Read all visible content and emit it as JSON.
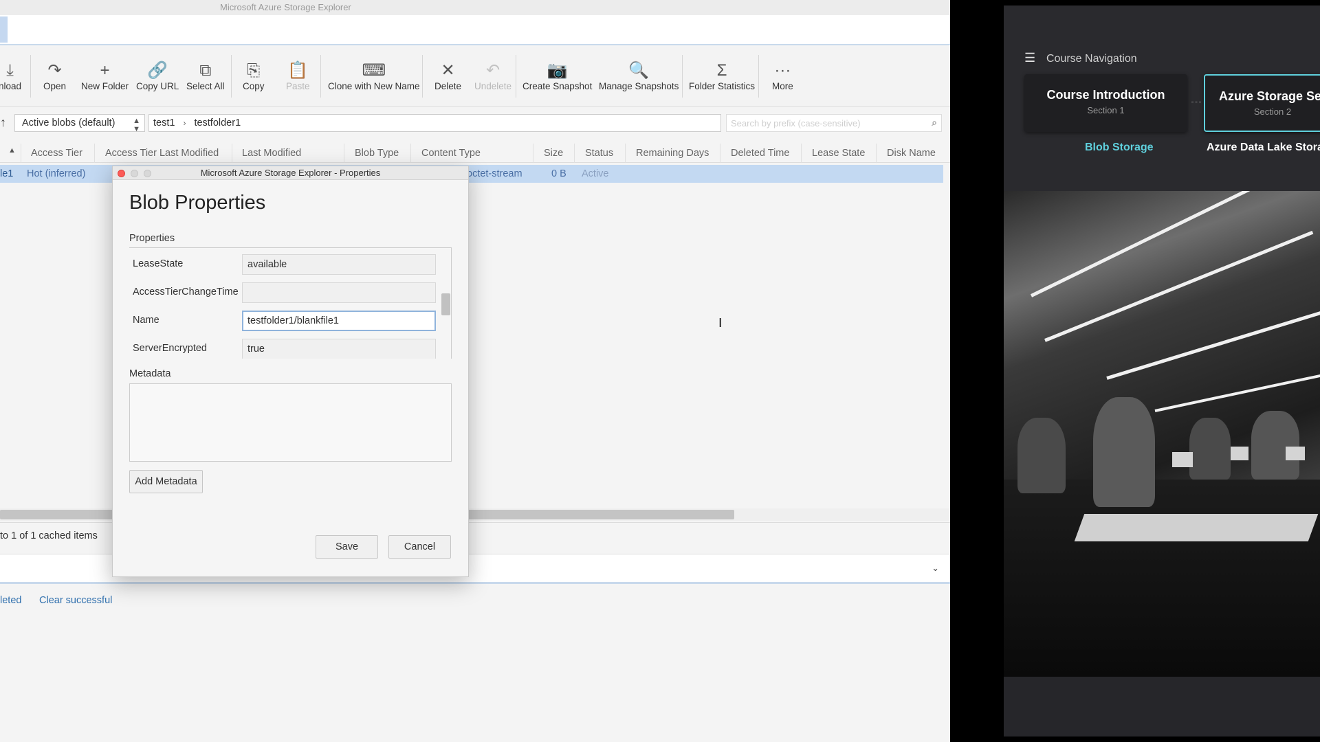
{
  "app": {
    "title": "Microsoft Azure Storage Explorer",
    "toolbar": {
      "download": "nload",
      "open": "Open",
      "new_folder": "New Folder",
      "copy_url": "Copy URL",
      "select_all": "Select All",
      "copy": "Copy",
      "paste": "Paste",
      "clone": "Clone with New Name",
      "delete": "Delete",
      "undelete": "Undelete",
      "create_snapshot": "Create Snapshot",
      "manage_snapshots": "Manage Snapshots",
      "folder_statistics": "Folder Statistics",
      "more": "More"
    },
    "view_selector": "Active blobs (default)",
    "breadcrumb": [
      "test1",
      "testfolder1"
    ],
    "search_placeholder": "Search by prefix (case-sensitive)",
    "columns": [
      "Access Tier",
      "Access Tier Last Modified",
      "Last Modified",
      "Blob Type",
      "Content Type",
      "Size",
      "Status",
      "Remaining Days",
      "Deleted Time",
      "Lease State",
      "Disk Name"
    ],
    "row": {
      "name": "le1",
      "access_tier": "Hot (inferred)",
      "content_type": "octet-stream",
      "size": "0 B",
      "status": "Active"
    },
    "status_text": "to 1 of 1 cached items",
    "activity_links": {
      "completed": "leted",
      "clear_successful": "Clear successful"
    }
  },
  "dialog": {
    "window_title": "Microsoft Azure Storage Explorer - Properties",
    "heading": "Blob Properties",
    "properties_label": "Properties",
    "properties": [
      {
        "name": "LeaseState",
        "value": "available"
      },
      {
        "name": "AccessTierChangeTime",
        "value": ""
      },
      {
        "name": "Name",
        "value": "testfolder1/blankfile1"
      },
      {
        "name": "ServerEncrypted",
        "value": "true"
      }
    ],
    "metadata_label": "Metadata",
    "add_metadata": "Add Metadata",
    "save": "Save",
    "cancel": "Cancel"
  },
  "course": {
    "nav_title": "Course Navigation",
    "cards": [
      {
        "title": "Course Introduction",
        "section": "Section 1"
      },
      {
        "title": "Azure Storage Ser",
        "section": "Section 2"
      }
    ],
    "lessons": [
      "Blob Storage",
      "Azure Data Lake Stora"
    ],
    "accent_color": "#5fd0dd"
  }
}
